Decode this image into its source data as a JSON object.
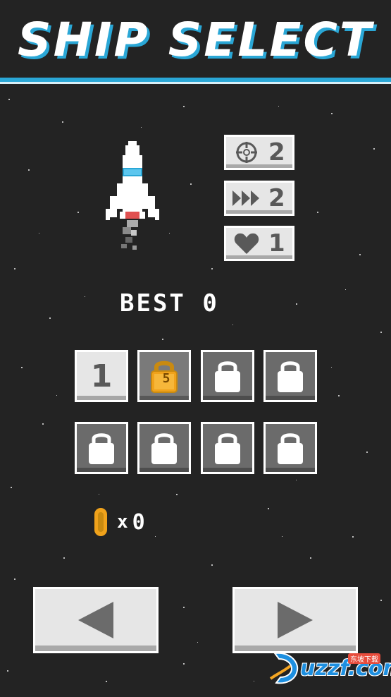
{
  "title": "SHIP SELECT",
  "colors": {
    "accent": "#2aa7d6",
    "panel": "#e6e6e6",
    "locked": "#6b6b6b",
    "coin": "#f0a21b"
  },
  "stats": [
    {
      "icon": "crosshair-icon",
      "value": "2"
    },
    {
      "icon": "speed-arrows-icon",
      "value": "2"
    },
    {
      "icon": "heart-icon",
      "value": "1"
    }
  ],
  "best": "BEST 0",
  "ships": [
    {
      "state": "unlocked",
      "label": "1"
    },
    {
      "state": "locked-price",
      "label": "5"
    },
    {
      "state": "locked",
      "label": ""
    },
    {
      "state": "locked",
      "label": ""
    },
    {
      "state": "locked",
      "label": ""
    },
    {
      "state": "locked",
      "label": ""
    },
    {
      "state": "locked",
      "label": ""
    },
    {
      "state": "locked",
      "label": ""
    }
  ],
  "coins": {
    "x": "x",
    "count": "0"
  },
  "nav": {
    "prev_icon": "left-arrow-icon",
    "next_icon": "right-arrow-icon"
  },
  "watermark": {
    "text": "uzzf.com",
    "sub": "东坡下载"
  }
}
